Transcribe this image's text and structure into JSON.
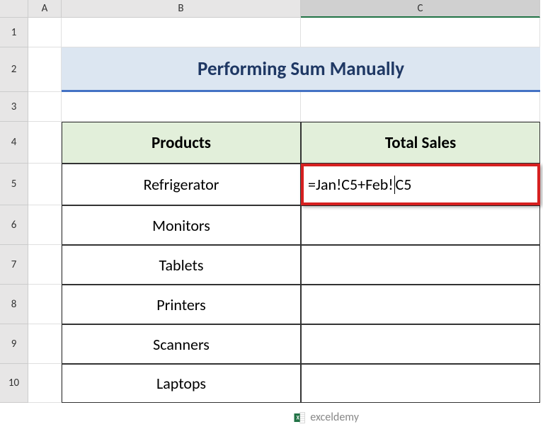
{
  "columns": [
    "",
    "A",
    "B",
    "C"
  ],
  "rows": [
    "1",
    "2",
    "3",
    "4",
    "5",
    "6",
    "7",
    "8",
    "9",
    "10"
  ],
  "title": "Performing Sum Manually",
  "headers": {
    "products": "Products",
    "totalSales": "Total Sales"
  },
  "products": [
    "Refrigerator",
    "Monitors",
    "Tablets",
    "Printers",
    "Scanners",
    "Laptops"
  ],
  "formula": {
    "prefix": "=Jan!C5+Feb!",
    "suffix": "C5"
  },
  "watermark": {
    "text1": "exceldemy",
    "text2": ""
  },
  "activeRow": "5",
  "activeCol": "C",
  "chart_data": {
    "type": "table",
    "title": "Performing Sum Manually",
    "columns": [
      "Products",
      "Total Sales"
    ],
    "rows": [
      [
        "Refrigerator",
        "=Jan!C5+Feb!C5"
      ],
      [
        "Monitors",
        ""
      ],
      [
        "Tablets",
        ""
      ],
      [
        "Printers",
        ""
      ],
      [
        "Scanners",
        ""
      ],
      [
        "Laptops",
        ""
      ]
    ]
  }
}
